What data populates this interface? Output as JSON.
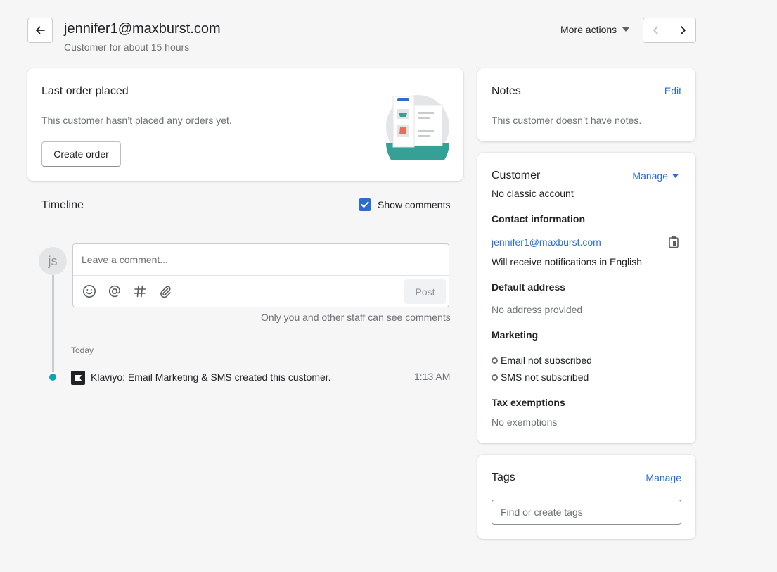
{
  "header": {
    "title": "jennifer1@maxburst.com",
    "subtitle": "Customer for about 15 hours",
    "more_actions": "More actions"
  },
  "last_order": {
    "title": "Last order placed",
    "empty_text": "This customer hasn’t placed any orders yet.",
    "create_button": "Create order"
  },
  "timeline": {
    "title": "Timeline",
    "show_comments_label": "Show comments",
    "show_comments_checked": true,
    "avatar_initials": "js",
    "comment_placeholder": "Leave a comment...",
    "post_button": "Post",
    "staff_note": "Only you and other staff can see comments",
    "group_label": "Today",
    "events": [
      {
        "text": "Klaviyo: Email Marketing & SMS created this customer.",
        "time": "1:13 AM"
      }
    ]
  },
  "notes": {
    "title": "Notes",
    "edit_link": "Edit",
    "empty_text": "This customer doesn’t have notes."
  },
  "customer": {
    "title": "Customer",
    "manage_link": "Manage",
    "account_status": "No classic account",
    "contact_heading": "Contact information",
    "email": "jennifer1@maxburst.com",
    "notifications": "Will receive notifications in English",
    "address_heading": "Default address",
    "address_text": "No address provided",
    "marketing_heading": "Marketing",
    "marketing_email": "Email not subscribed",
    "marketing_sms": "SMS not subscribed",
    "tax_heading": "Tax exemptions",
    "tax_text": "No exemptions"
  },
  "tags": {
    "title": "Tags",
    "manage_link": "Manage",
    "input_placeholder": "Find or create tags"
  },
  "colors": {
    "accent": "#2c6ecb",
    "timeline_dot": "#0ba3b2",
    "background": "#f6f6f7"
  }
}
